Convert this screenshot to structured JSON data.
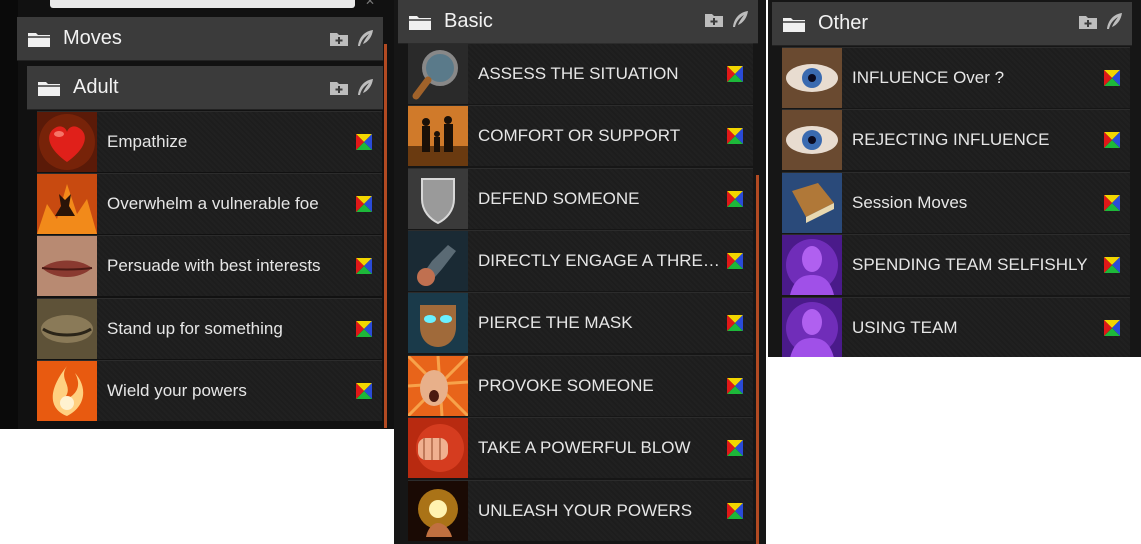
{
  "left_panel": {
    "moves_folder": {
      "title": "Moves"
    },
    "adult_folder": {
      "title": "Adult"
    },
    "items": [
      {
        "label": "Empathize",
        "icon": "heart-icon"
      },
      {
        "label": "Overwhelm a vulnerable foe",
        "icon": "fire-demon-icon"
      },
      {
        "label": "Persuade with best interests",
        "icon": "lips-icon"
      },
      {
        "label": "Stand up for something",
        "icon": "closed-eye-icon"
      },
      {
        "label": "Wield your powers",
        "icon": "flame-power-icon"
      }
    ]
  },
  "mid_panel": {
    "folder": {
      "title": "Basic"
    },
    "items": [
      {
        "label": "ASSESS THE SITUATION",
        "icon": "magnifier-icon"
      },
      {
        "label": "COMFORT OR SUPPORT",
        "icon": "family-silhouette-icon"
      },
      {
        "label": "DEFEND SOMEONE",
        "icon": "shield-icon"
      },
      {
        "label": "DIRECTLY ENGAGE A THRE…",
        "icon": "gauntlet-fist-icon"
      },
      {
        "label": "PIERCE THE MASK",
        "icon": "mask-icon"
      },
      {
        "label": "PROVOKE SOMEONE",
        "icon": "shouting-face-icon"
      },
      {
        "label": "TAKE A POWERFUL BLOW",
        "icon": "punch-icon"
      },
      {
        "label": "UNLEASH YOUR POWERS",
        "icon": "glowing-hand-icon"
      }
    ]
  },
  "right_panel": {
    "folder": {
      "title": "Other"
    },
    "items": [
      {
        "label": "INFLUENCE Over ?",
        "icon": "eye-icon"
      },
      {
        "label": "REJECTING INFLUENCE",
        "icon": "eye-icon"
      },
      {
        "label": "Session Moves",
        "icon": "book-icon"
      },
      {
        "label": "SPENDING TEAM SELFISHLY",
        "icon": "purple-figure-icon"
      },
      {
        "label": "USING TEAM",
        "icon": "purple-figure-icon"
      }
    ]
  },
  "colors": {
    "header_bg": "#3b3b3b",
    "row_bg": "#1d1d1d",
    "scrollbar": "#b24a22",
    "text": "#e6e6e6"
  },
  "icons": {
    "folder": "folder-icon",
    "add_folder": "add-folder-icon",
    "quill": "quill-icon",
    "macro_badge": "tricolor-badge-icon"
  }
}
